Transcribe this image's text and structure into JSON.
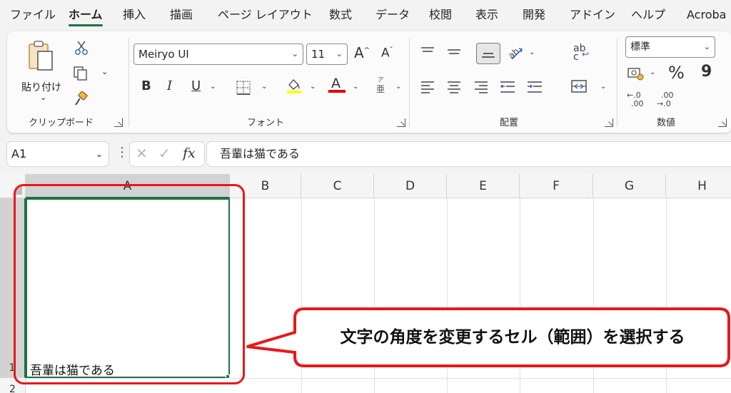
{
  "menu": {
    "tabs": [
      {
        "label": "ファイル",
        "active": false
      },
      {
        "label": "ホーム",
        "active": true
      },
      {
        "label": "挿入",
        "active": false
      },
      {
        "label": "描画",
        "active": false
      },
      {
        "label": "ページ レイアウト",
        "active": false
      },
      {
        "label": "数式",
        "active": false
      },
      {
        "label": "データ",
        "active": false
      },
      {
        "label": "校閲",
        "active": false
      },
      {
        "label": "表示",
        "active": false
      },
      {
        "label": "開発",
        "active": false
      },
      {
        "label": "アドイン",
        "active": false
      },
      {
        "label": "ヘルプ",
        "active": false
      },
      {
        "label": "Acroba",
        "active": false
      }
    ]
  },
  "clipboard": {
    "paste_label": "貼り付け",
    "group_label": "クリップボード"
  },
  "font": {
    "font_name": "Meiryo UI",
    "font_size": "11",
    "bold": "B",
    "italic": "I",
    "underline": "U",
    "phonetic": "亜",
    "phonetic_top": "ア",
    "group_label": "フォント",
    "fill_color": "#ffff00",
    "font_color": "#e00000"
  },
  "alignment": {
    "group_label": "配置",
    "wrap_top": "ab",
    "wrap_bottom": "c"
  },
  "number": {
    "format": "標準",
    "percent": "%",
    "comma": "9",
    "inc_decimal_top": "←.0",
    "inc_decimal_bottom": ".00",
    "dec_decimal_top": ".00",
    "dec_decimal_bottom": "→.0",
    "group_label": "数値"
  },
  "formula_bar": {
    "name_box": "A1",
    "fx": "fx",
    "content": "吾輩は猫である"
  },
  "grid": {
    "columns": [
      "A",
      "B",
      "C",
      "D",
      "E",
      "F",
      "G",
      "H"
    ],
    "rows": [
      "1",
      "2"
    ],
    "cell_a1": "吾輩は猫である"
  },
  "annotation": {
    "callout": "文字の角度を変更するセル（範囲）を選択する",
    "color": "#e5191b"
  }
}
